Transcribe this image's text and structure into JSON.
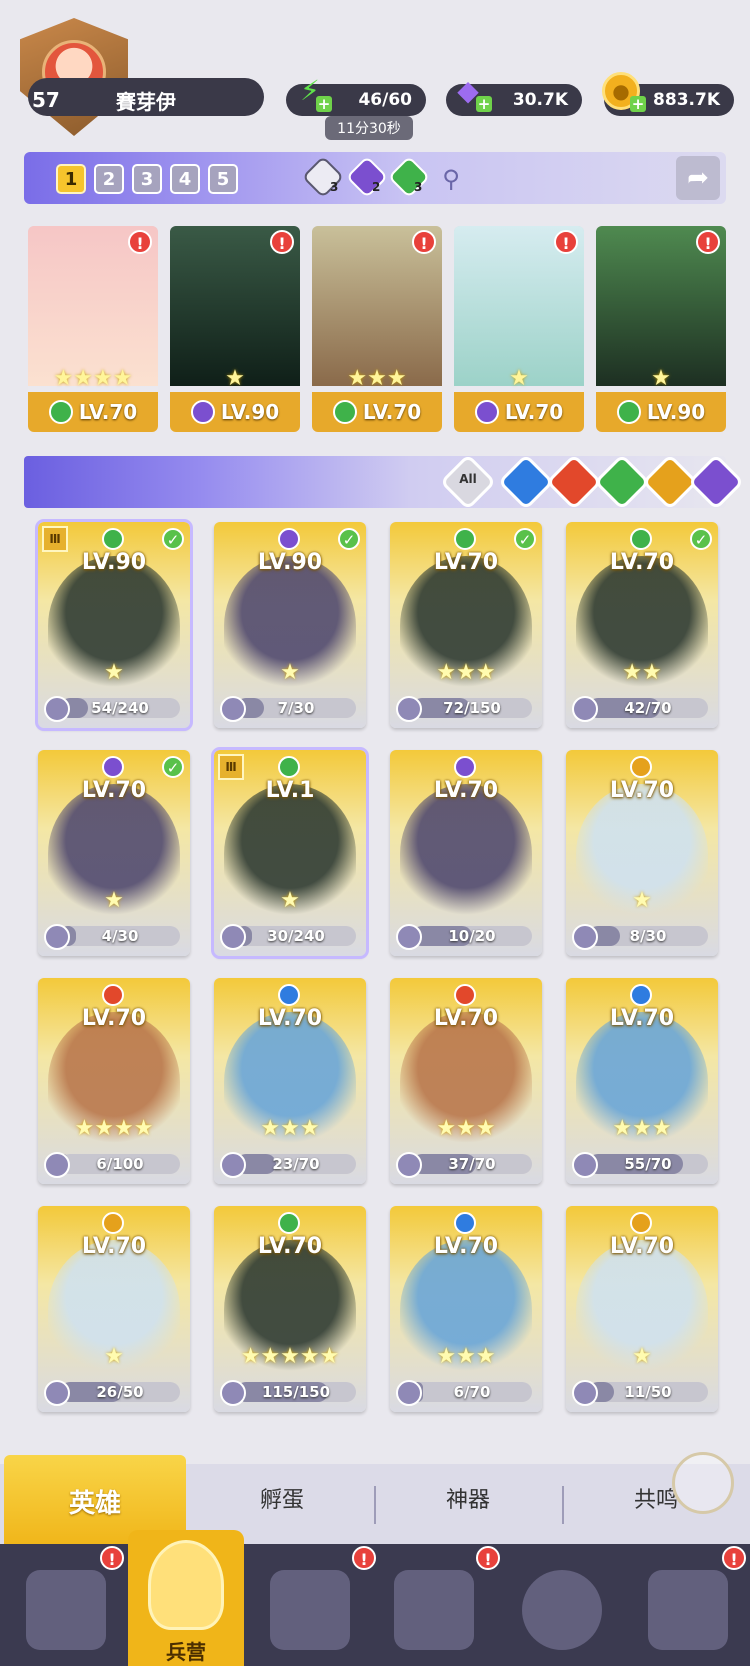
{
  "player": {
    "level": "57",
    "name": "賽芽伊"
  },
  "resources": {
    "energy": {
      "icon": "lightning-icon",
      "value": "46/60",
      "timer": "11分30秒"
    },
    "gems": {
      "icon": "diamond-icon",
      "value": "30.7K"
    },
    "coins": {
      "icon": "coin-icon",
      "value": "883.7K"
    }
  },
  "team": {
    "tabs": [
      "1",
      "2",
      "3",
      "4",
      "5"
    ],
    "active_tab": "1",
    "element_counts": [
      {
        "icon": "light-element-icon",
        "count": "3"
      },
      {
        "icon": "dark-element-icon",
        "count": "2"
      },
      {
        "icon": "nature-element-icon",
        "count": "3"
      }
    ],
    "members": [
      {
        "level": "LV.70",
        "element": "nature",
        "stars": "★★★★"
      },
      {
        "level": "LV.90",
        "element": "dark",
        "stars": "★"
      },
      {
        "level": "LV.70",
        "element": "nature",
        "stars": "★★★"
      },
      {
        "level": "LV.70",
        "element": "dark",
        "stars": "★"
      },
      {
        "level": "LV.90",
        "element": "nature",
        "stars": "★"
      }
    ]
  },
  "filters": {
    "all_label": "All",
    "elements": [
      "water",
      "fire",
      "nature",
      "light",
      "dark"
    ]
  },
  "colors": {
    "nature": "#3fb24a",
    "dark": "#7b4fcf",
    "water": "#2f7ce0",
    "fire": "#e2482b",
    "light": "#e5a11c",
    "accent": "#f3c93a"
  },
  "heroes": [
    {
      "level": "LV.90",
      "element": "nature",
      "stars": "★",
      "progress": "54/240",
      "ratio": 0.225,
      "checked": true,
      "tier": true,
      "selected": true
    },
    {
      "level": "LV.90",
      "element": "dark",
      "stars": "★",
      "progress": "7/30",
      "ratio": 0.23,
      "checked": true
    },
    {
      "level": "LV.70",
      "element": "nature",
      "stars": "★★★",
      "progress": "72/150",
      "ratio": 0.48,
      "checked": true
    },
    {
      "level": "LV.70",
      "element": "nature",
      "stars": "★★",
      "progress": "42/70",
      "ratio": 0.6,
      "checked": true
    },
    {
      "level": "LV.70",
      "element": "dark",
      "stars": "★",
      "progress": "4/30",
      "ratio": 0.13,
      "checked": true
    },
    {
      "level": "LV.1",
      "element": "nature",
      "stars": "★",
      "progress": "30/240",
      "ratio": 0.125,
      "tier": true,
      "selected": true
    },
    {
      "level": "LV.70",
      "element": "dark",
      "stars": "",
      "progress": "10/20",
      "ratio": 0.5
    },
    {
      "level": "LV.70",
      "element": "light",
      "stars": "★",
      "progress": "8/30",
      "ratio": 0.27
    },
    {
      "level": "LV.70",
      "element": "fire",
      "stars": "★★★★",
      "progress": "6/100",
      "ratio": 0.06
    },
    {
      "level": "LV.70",
      "element": "water",
      "stars": "★★★",
      "progress": "23/70",
      "ratio": 0.33
    },
    {
      "level": "LV.70",
      "element": "fire",
      "stars": "★★★",
      "progress": "37/70",
      "ratio": 0.53
    },
    {
      "level": "LV.70",
      "element": "water",
      "stars": "★★★",
      "progress": "55/70",
      "ratio": 0.79
    },
    {
      "level": "LV.70",
      "element": "light",
      "stars": "★",
      "progress": "26/50",
      "ratio": 0.52
    },
    {
      "level": "LV.70",
      "element": "nature",
      "stars": "★★★★★",
      "progress": "115/150",
      "ratio": 0.77
    },
    {
      "level": "LV.70",
      "element": "water",
      "stars": "★★★",
      "progress": "6/70",
      "ratio": 0.09
    },
    {
      "level": "LV.70",
      "element": "light",
      "stars": "★",
      "progress": "11/50",
      "ratio": 0.22
    }
  ],
  "subtabs": {
    "active": "英雄",
    "hatch": "孵蛋",
    "artifact": "神器",
    "resonance": "共鸣"
  },
  "bottom_nav": {
    "active_label": "兵营"
  }
}
